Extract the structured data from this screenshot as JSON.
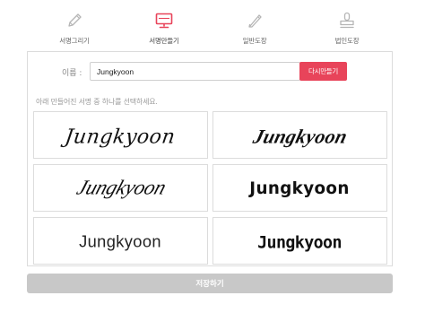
{
  "tabs": [
    {
      "label": "서명그리기",
      "icon": "pencil-icon",
      "active": false
    },
    {
      "label": "서명만들기",
      "icon": "monitor-icon",
      "active": true
    },
    {
      "label": "일반도장",
      "icon": "pen-icon",
      "active": false
    },
    {
      "label": "법인도장",
      "icon": "stamp-icon",
      "active": false
    }
  ],
  "colors": {
    "accent": "#e8445a",
    "save_disabled": "#c8c8c8",
    "border": "#dcdcdc"
  },
  "name_form": {
    "label": "이름 :",
    "value": "Jungkyoon",
    "regenerate_label": "다시만들기"
  },
  "instruction": "아래 만들어진 서명 중 하나를 선택하세요.",
  "signatures": [
    {
      "text": "Jungkyoon",
      "style": "script-italic"
    },
    {
      "text": "Jungkyoon",
      "style": "brush-script"
    },
    {
      "text": "Jungkyoon",
      "style": "elegant-script"
    },
    {
      "text": "Jungkyoon",
      "style": "marker-bold"
    },
    {
      "text": "Jungkyoon",
      "style": "plain-sans"
    },
    {
      "text": "Jungkyoon",
      "style": "bouncy-marker"
    }
  ],
  "save_label": "저장하기"
}
